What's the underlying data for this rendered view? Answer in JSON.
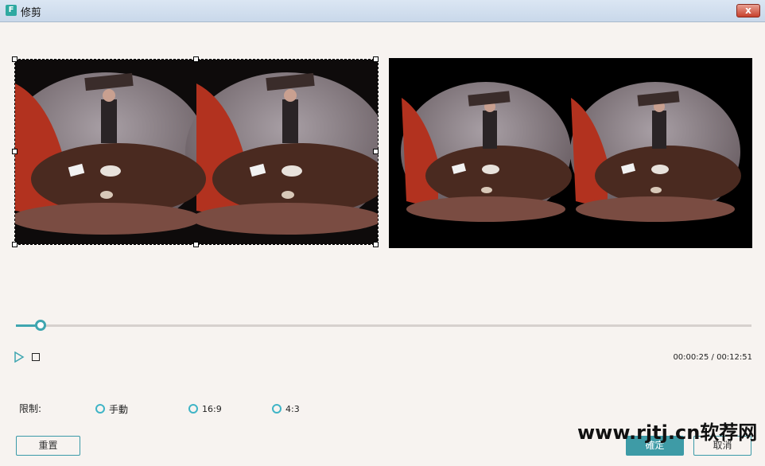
{
  "window": {
    "title": "修剪",
    "app_icon": "F",
    "close_label": "x"
  },
  "playback": {
    "time_display": "00:00:25 / 00:12:51",
    "progress": 0.033
  },
  "limit": {
    "label": "限制:",
    "options": [
      {
        "label": "手動"
      },
      {
        "label": "16:9"
      },
      {
        "label": "4:3"
      }
    ]
  },
  "buttons": {
    "reset": "重置",
    "ok": "確定",
    "cancel": "取消"
  },
  "watermark": "www.rjtj.cn软荐网",
  "colors": {
    "accent": "#3e9ba6",
    "radio": "#3fb4c6"
  }
}
